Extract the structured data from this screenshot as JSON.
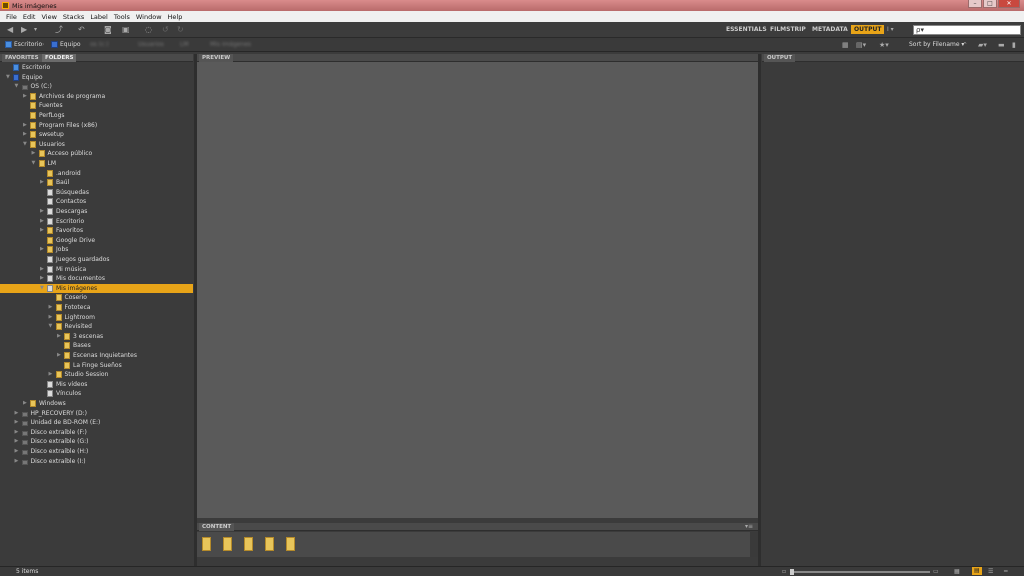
{
  "window": {
    "title": "Mis imágenes"
  },
  "menu": [
    "File",
    "Edit",
    "View",
    "Stacks",
    "Label",
    "Tools",
    "Window",
    "Help"
  ],
  "workspaces": [
    "ESSENTIALS",
    "FILMSTRIP",
    "METADATA",
    "OUTPUT"
  ],
  "active_workspace": "OUTPUT",
  "search": {
    "placeholder": "ρ▾"
  },
  "path": {
    "items": [
      "Escritorio",
      "Equipo"
    ],
    "blurred": [
      "os (c:)",
      "Usuarios",
      "LM",
      "Mis imágenes"
    ]
  },
  "sort": {
    "label": "Sort by Filename ▾"
  },
  "panels": {
    "favorites_tab": "FAVORITES",
    "folders_tab": "FOLDERS",
    "preview_tab": "PREVIEW",
    "output_tab": "OUTPUT",
    "content_tab": "CONTENT"
  },
  "tree": [
    {
      "label": "Escritorio",
      "indent": 0,
      "icon": "desktop",
      "twisty": "",
      "sel": false
    },
    {
      "label": "Equipo",
      "indent": 0,
      "icon": "computer",
      "twisty": "▼",
      "sel": false
    },
    {
      "label": "OS (C:)",
      "indent": 1,
      "icon": "drive",
      "twisty": "▼",
      "sel": false
    },
    {
      "label": "Archivos de programa",
      "indent": 2,
      "icon": "folder",
      "twisty": "▶",
      "sel": false
    },
    {
      "label": "Fuentes",
      "indent": 2,
      "icon": "folder",
      "twisty": "",
      "sel": false
    },
    {
      "label": "PerfLogs",
      "indent": 2,
      "icon": "folder",
      "twisty": "",
      "sel": false
    },
    {
      "label": "Program Files (x86)",
      "indent": 2,
      "icon": "folder",
      "twisty": "▶",
      "sel": false
    },
    {
      "label": "swsetup",
      "indent": 2,
      "icon": "folder",
      "twisty": "▶",
      "sel": false
    },
    {
      "label": "Usuarios",
      "indent": 2,
      "icon": "folder",
      "twisty": "▼",
      "sel": false
    },
    {
      "label": "Acceso público",
      "indent": 3,
      "icon": "folder",
      "twisty": "▶",
      "sel": false
    },
    {
      "label": "LM",
      "indent": 3,
      "icon": "folder",
      "twisty": "▼",
      "sel": false
    },
    {
      "label": ".android",
      "indent": 4,
      "icon": "folder",
      "twisty": "",
      "sel": false
    },
    {
      "label": "Baúl",
      "indent": 4,
      "icon": "folder",
      "twisty": "▶",
      "sel": false
    },
    {
      "label": "Búsquedas",
      "indent": 4,
      "icon": "special",
      "twisty": "",
      "sel": false
    },
    {
      "label": "Contactos",
      "indent": 4,
      "icon": "special",
      "twisty": "",
      "sel": false
    },
    {
      "label": "Descargas",
      "indent": 4,
      "icon": "special",
      "twisty": "▶",
      "sel": false
    },
    {
      "label": "Escritorio",
      "indent": 4,
      "icon": "special",
      "twisty": "▶",
      "sel": false
    },
    {
      "label": "Favoritos",
      "indent": 4,
      "icon": "folder",
      "twisty": "▶",
      "sel": false
    },
    {
      "label": "Google Drive",
      "indent": 4,
      "icon": "folder",
      "twisty": "",
      "sel": false
    },
    {
      "label": "Jobs",
      "indent": 4,
      "icon": "folder",
      "twisty": "▶",
      "sel": false
    },
    {
      "label": "Juegos guardados",
      "indent": 4,
      "icon": "special",
      "twisty": "",
      "sel": false
    },
    {
      "label": "Mi música",
      "indent": 4,
      "icon": "special",
      "twisty": "▶",
      "sel": false
    },
    {
      "label": "Mis documentos",
      "indent": 4,
      "icon": "special",
      "twisty": "▶",
      "sel": false
    },
    {
      "label": "Mis imágenes",
      "indent": 4,
      "icon": "special",
      "twisty": "▼",
      "sel": true
    },
    {
      "label": "Coserio",
      "indent": 5,
      "icon": "folder",
      "twisty": "",
      "sel": false
    },
    {
      "label": "Fototeca",
      "indent": 5,
      "icon": "folder",
      "twisty": "▶",
      "sel": false
    },
    {
      "label": "Lightroom",
      "indent": 5,
      "icon": "folder",
      "twisty": "▶",
      "sel": false
    },
    {
      "label": "Revisited",
      "indent": 5,
      "icon": "folder",
      "twisty": "▼",
      "sel": false
    },
    {
      "label": "3 escenas",
      "indent": 6,
      "icon": "folder",
      "twisty": "▶",
      "sel": false
    },
    {
      "label": "Bases",
      "indent": 6,
      "icon": "folder",
      "twisty": "",
      "sel": false
    },
    {
      "label": "Escenas Inquietantes",
      "indent": 6,
      "icon": "folder",
      "twisty": "▶",
      "sel": false
    },
    {
      "label": "La Finge Sueños",
      "indent": 6,
      "icon": "folder",
      "twisty": "",
      "sel": false
    },
    {
      "label": "Studio Session",
      "indent": 5,
      "icon": "folder",
      "twisty": "▶",
      "sel": false
    },
    {
      "label": "Mis vídeos",
      "indent": 4,
      "icon": "special",
      "twisty": "",
      "sel": false
    },
    {
      "label": "Vínculos",
      "indent": 4,
      "icon": "special",
      "twisty": "",
      "sel": false
    },
    {
      "label": "Windows",
      "indent": 2,
      "icon": "folder",
      "twisty": "▶",
      "sel": false
    },
    {
      "label": "HP_RECOVERY (D:)",
      "indent": 1,
      "icon": "drive",
      "twisty": "▶",
      "sel": false
    },
    {
      "label": "Unidad de BD-ROM (E:)",
      "indent": 1,
      "icon": "drive",
      "twisty": "▶",
      "sel": false
    },
    {
      "label": "Disco extraíble (F:)",
      "indent": 1,
      "icon": "drive",
      "twisty": "▶",
      "sel": false
    },
    {
      "label": "Disco extraíble (G:)",
      "indent": 1,
      "icon": "drive",
      "twisty": "▶",
      "sel": false
    },
    {
      "label": "Disco extraíble (H:)",
      "indent": 1,
      "icon": "drive",
      "twisty": "▶",
      "sel": false
    },
    {
      "label": "Disco extraíble (I:)",
      "indent": 1,
      "icon": "drive",
      "twisty": "▶",
      "sel": false
    }
  ],
  "status": {
    "count": "5 items"
  },
  "colors": {
    "accent": "#e8a418",
    "panel": "#3b3b3b",
    "preview": "#5a5a5a"
  }
}
